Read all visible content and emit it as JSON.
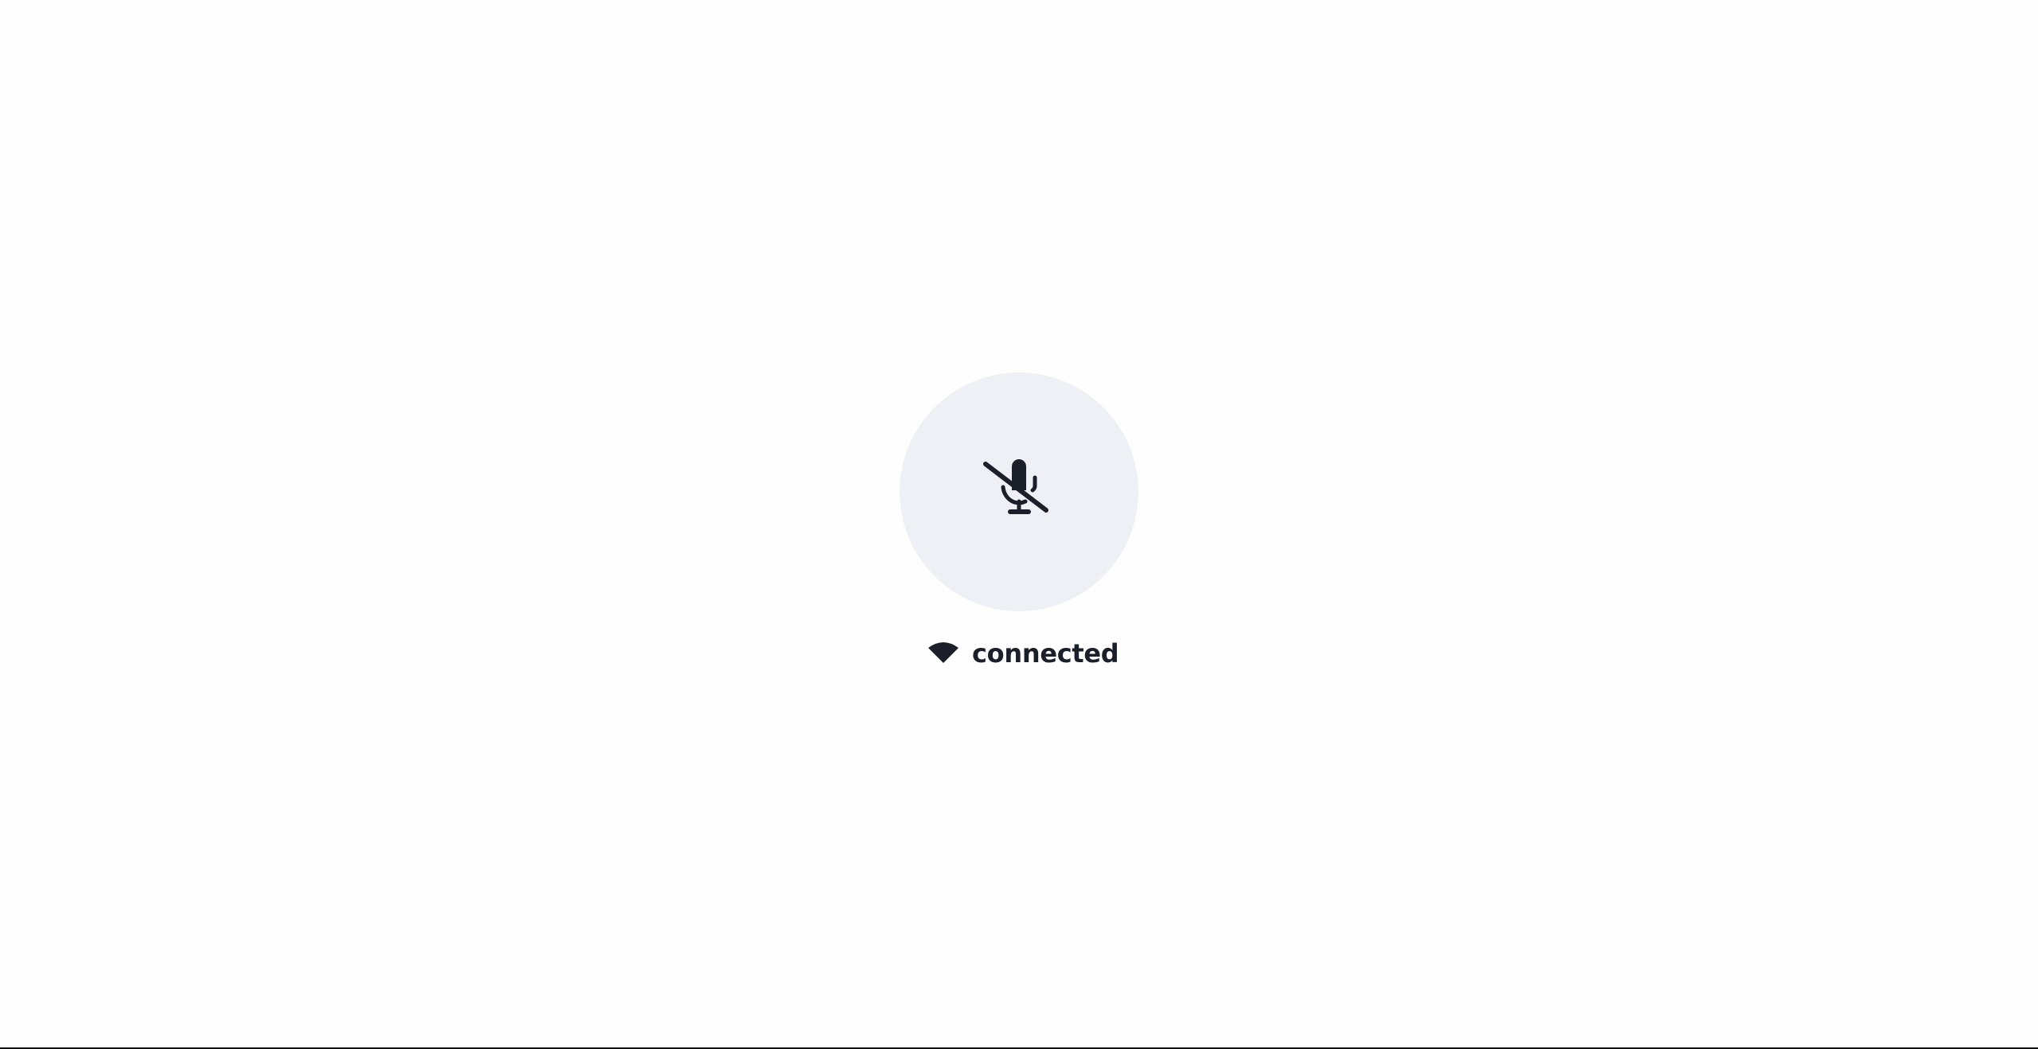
{
  "mic": {
    "state": "muted",
    "icon": "mic-off-icon",
    "background_color": "#eef0f5",
    "icon_color": "#1b1f2a"
  },
  "status": {
    "icon": "signal-icon",
    "text": "connected"
  }
}
